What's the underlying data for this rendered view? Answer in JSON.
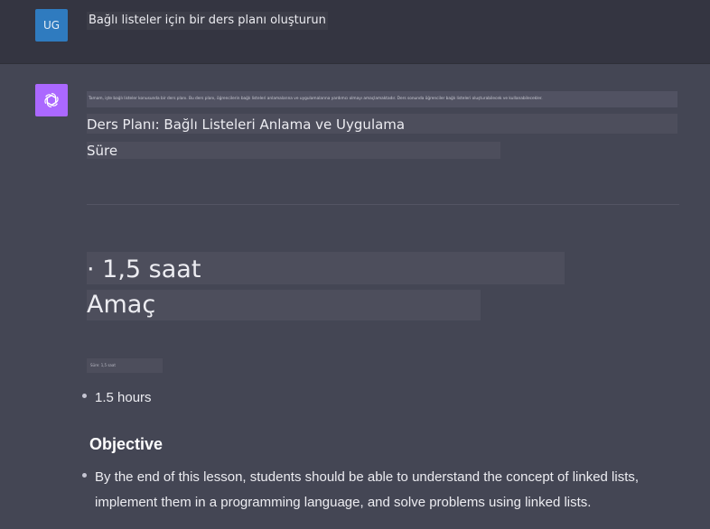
{
  "user": {
    "avatar_initials": "UG",
    "message": "Bağlı listeler için bir ders planı oluşturun"
  },
  "assistant": {
    "avatar_icon": "openai-logo-icon",
    "tiny_text": "Tamam, işte bağlı listeler konusunda bir ders planı. Bu ders planı, öğrencilerin bağlı listeleri anlamalarına ve uygulamalarına yardımcı olmayı amaçlamaktadır. Ders sonunda öğrenciler bağlı listeleri oluşturabilecek ve kullanabilecekler.",
    "lesson_title": "Ders Planı: Bağlı Listeleri Anlama ve Uygulama",
    "duration_heading": "Süre",
    "big_duration": "· 1,5 saat",
    "big_objective": "Amaç",
    "small_text": "Süre: 1,5 saat",
    "duration_bullet": "1.5 hours",
    "objective_heading": "Objective",
    "objective_line1": "By the end of this lesson, students should be able to understand the concept of linked lists,",
    "objective_line2": "implement them in a programming language, and solve problems using linked lists."
  },
  "colors": {
    "user_bg": "#343541",
    "assistant_bg": "#444654",
    "user_avatar": "#2f7bbf",
    "assistant_avatar": "#ab68ff",
    "text": "#ececf1"
  }
}
